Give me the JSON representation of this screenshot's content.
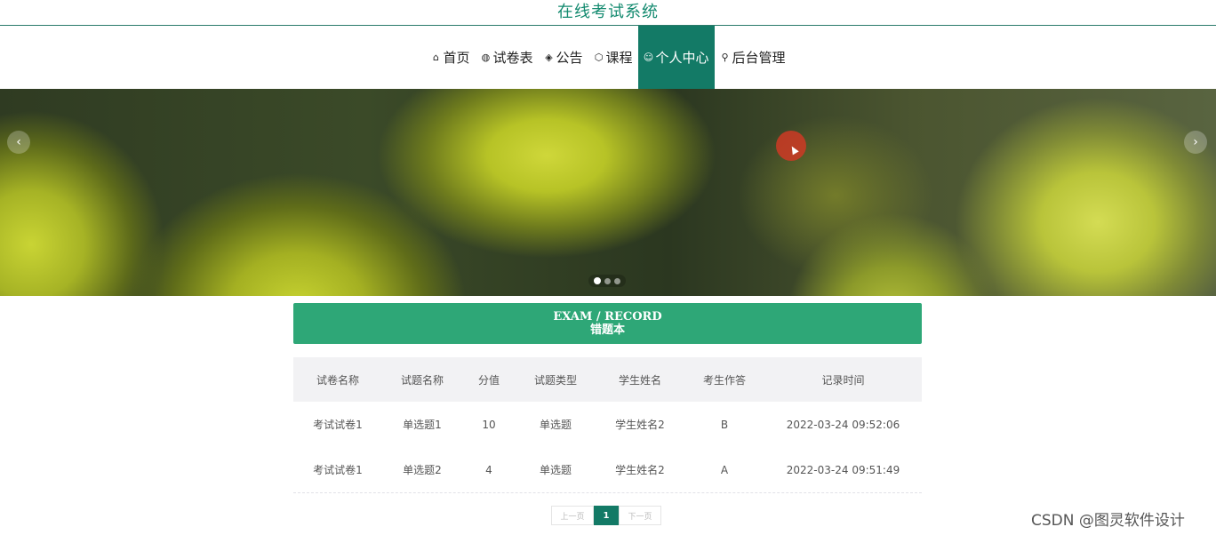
{
  "site": {
    "title": "在线考试系统"
  },
  "nav": {
    "items": [
      {
        "label": "首页",
        "icon": "home-icon",
        "glyph": "⌂",
        "active": false
      },
      {
        "label": "试卷表",
        "icon": "globe-icon",
        "glyph": "◍",
        "active": false
      },
      {
        "label": "公告",
        "icon": "layers-icon",
        "glyph": "◈",
        "active": false
      },
      {
        "label": "课程",
        "icon": "cube-icon",
        "glyph": "⬡",
        "active": false
      },
      {
        "label": "个人中心",
        "icon": "user-icon",
        "glyph": "☺",
        "active": true
      },
      {
        "label": "后台管理",
        "icon": "link-icon",
        "glyph": "⚲",
        "active": false
      }
    ]
  },
  "banner": {
    "prev_glyph": "‹",
    "next_glyph": "›",
    "slide_count": 3,
    "active_slide": 1
  },
  "section": {
    "title_en": "EXAM / RECORD",
    "title_cn": "错题本"
  },
  "table": {
    "columns": [
      "试卷名称",
      "试题名称",
      "分值",
      "试题类型",
      "学生姓名",
      "考生作答",
      "记录时间"
    ],
    "rows": [
      [
        "考试试卷1",
        "单选题1",
        "10",
        "单选题",
        "学生姓名2",
        "B",
        "2022-03-24 09:52:06"
      ],
      [
        "考试试卷1",
        "单选题2",
        "4",
        "单选题",
        "学生姓名2",
        "A",
        "2022-03-24 09:51:49"
      ]
    ]
  },
  "pagination": {
    "prev_label": "上一页",
    "current": "1",
    "next_label": "下一页"
  },
  "watermark": "CSDN @图灵软件设计",
  "colors": {
    "accent": "#137a66",
    "section": "#2ea777",
    "title": "#138a6f"
  }
}
